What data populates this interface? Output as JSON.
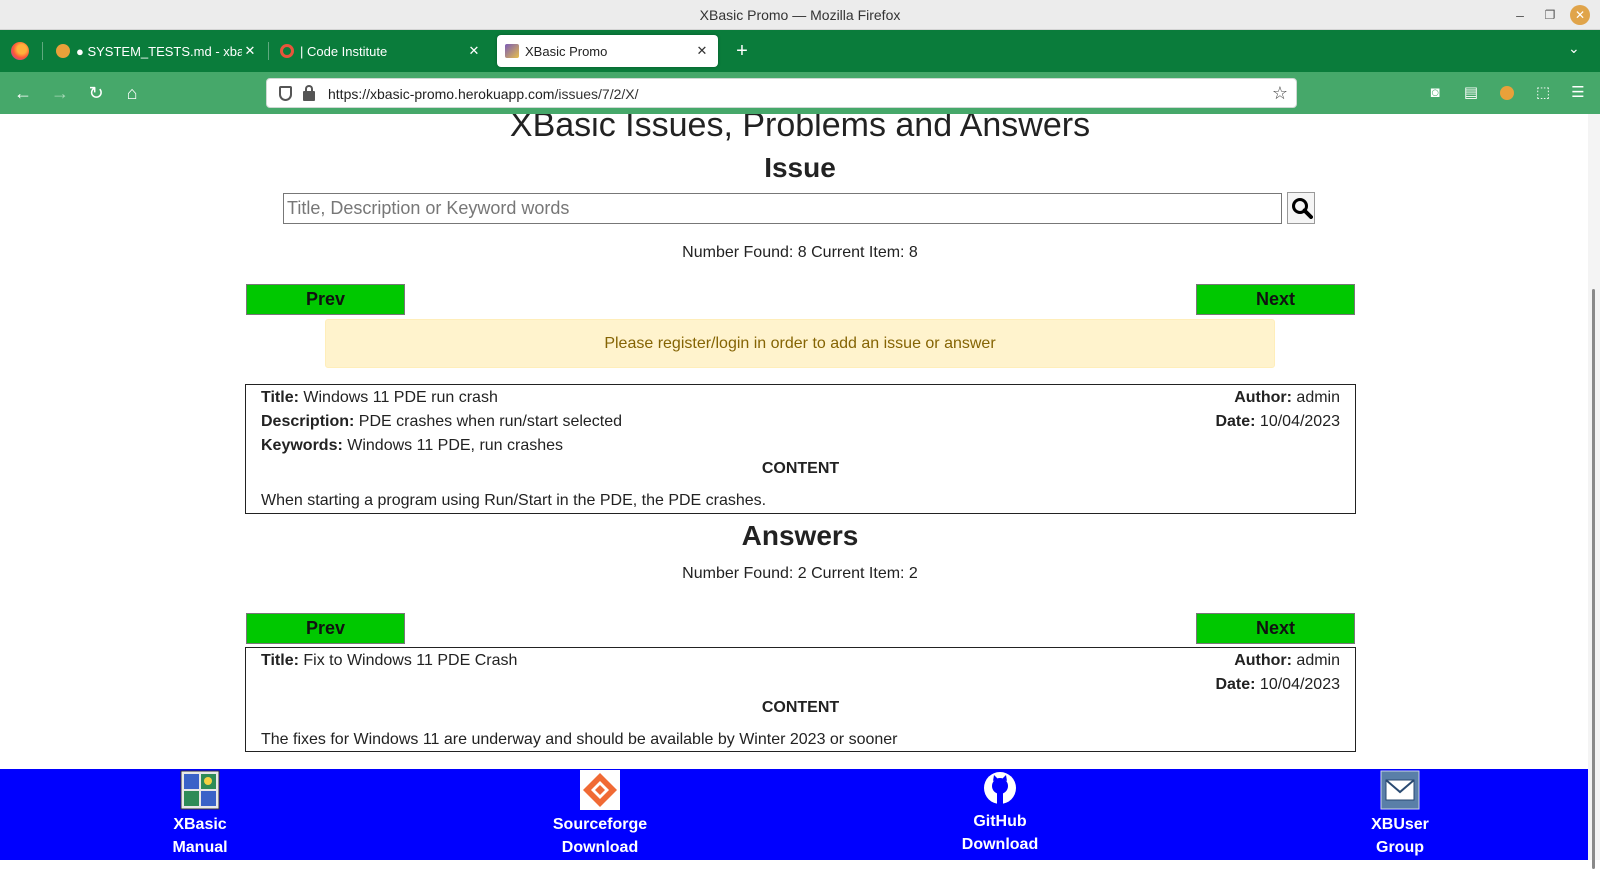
{
  "window": {
    "title": "XBasic Promo — Mozilla Firefox"
  },
  "tabs": [
    {
      "label": "● SYSTEM_TESTS.md - xbasic",
      "close": "✕"
    },
    {
      "label": "| Code Institute",
      "close": "✕"
    },
    {
      "label": "XBasic Promo",
      "close": "✕",
      "active": true
    }
  ],
  "nav": {
    "url_host": "https://xbasic-promo.herokuapp.com",
    "url_path": "/issues/7/2/X/"
  },
  "page": {
    "site_title": "XBasic Issues, Problems and Answers",
    "issue_heading": "Issue",
    "search_placeholder": "Title, Description or Keyword words",
    "issue_count": "Number Found: 8 Current Item: 8",
    "prev_label": "Prev",
    "next_label": "Next",
    "alert": "Please register/login in order to add an issue or answer",
    "issue": {
      "title_label": "Title:",
      "title": "Windows 11 PDE run crash",
      "description_label": "Description:",
      "description": "PDE crashes when run/start selected",
      "keywords_label": "Keywords:",
      "keywords": "Windows 11 PDE, run crashes",
      "author_label": "Author:",
      "author": "admin",
      "date_label": "Date:",
      "date": "10/04/2023",
      "content_label": "CONTENT",
      "content": "When starting a program using Run/Start in the PDE, the PDE crashes."
    },
    "answers_heading": "Answers",
    "answers_count": "Number Found: 2 Current Item: 2",
    "answer": {
      "title_label": "Title:",
      "title": "Fix to Windows 11 PDE Crash",
      "author_label": "Author:",
      "author": "admin",
      "date_label": "Date:",
      "date": "10/04/2023",
      "content_label": "CONTENT",
      "content": "The fixes for Windows 11 are underway and should be available by Winter 2023 or sooner"
    }
  },
  "footer": [
    {
      "line1": "XBasic",
      "line2": "Manual",
      "icon": "manual-icon"
    },
    {
      "line1": "Sourceforge",
      "line2": "Download",
      "icon": "sourceforge-icon"
    },
    {
      "line1": "GitHub",
      "line2": "Download",
      "icon": "github-icon"
    },
    {
      "line1": "XBUser",
      "line2": "Group",
      "icon": "mail-group-icon"
    }
  ],
  "colors": {
    "tabbar": "#0a7c3b",
    "navbar": "#46a86a",
    "button_green": "#00c800",
    "alert_bg": "#fff3cd",
    "alert_text": "#856404",
    "footer_blue": "#0000ff"
  }
}
